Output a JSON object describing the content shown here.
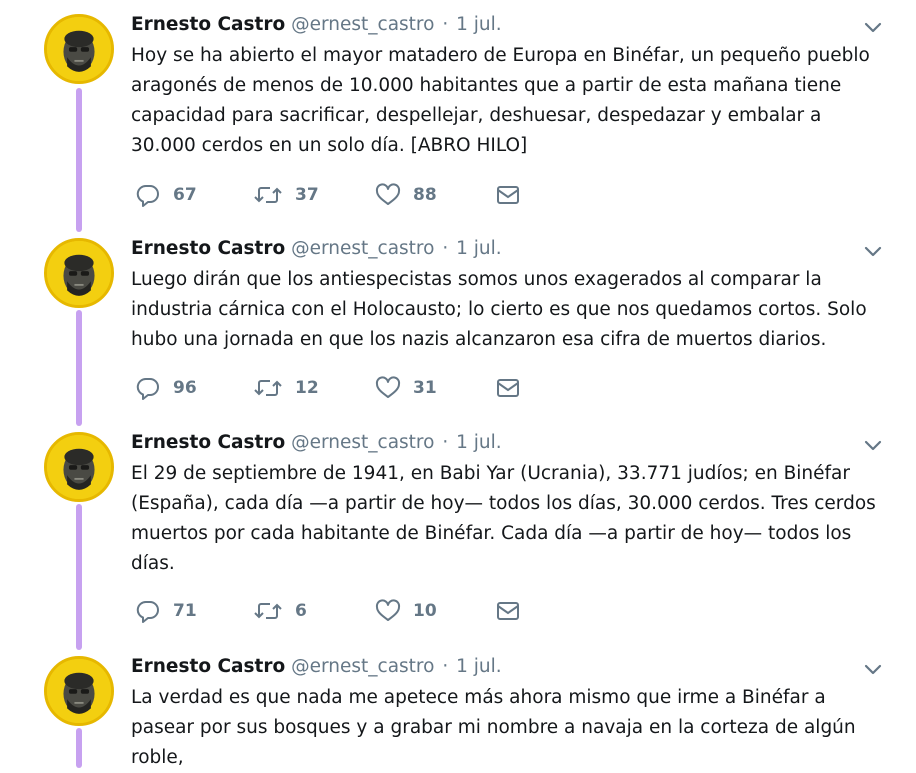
{
  "tweets": [
    {
      "name": "Ernesto Castro",
      "handle": "@ernest_castro",
      "date": "1 jul.",
      "text": "Hoy se ha abierto el mayor matadero de Europa en Binéfar, un pequeño pueblo aragonés de menos de 10.000 habitantes que a partir de esta mañana tiene capacidad para sacrificar, despellejar, deshuesar, despedazar y embalar a 30.000 cerdos en un solo día. [ABRO HILO]",
      "replies": "67",
      "retweets": "37",
      "likes": "88"
    },
    {
      "name": "Ernesto Castro",
      "handle": "@ernest_castro",
      "date": "1 jul.",
      "text": "Luego dirán que los antiespecistas somos unos exagerados al comparar la industria cárnica con el Holocausto; lo cierto es que nos quedamos cortos. Solo hubo una jornada en que los nazis alcanzaron esa cifra de muertos diarios.",
      "replies": "96",
      "retweets": "12",
      "likes": "31"
    },
    {
      "name": "Ernesto Castro",
      "handle": "@ernest_castro",
      "date": "1 jul.",
      "text": "El 29 de septiembre de 1941, en Babi Yar (Ucrania), 33.771 judíos; en Binéfar (España), cada día —a partir de hoy— todos los días, 30.000 cerdos. Tres cerdos muertos por cada habitante de Binéfar. Cada día —a partir de hoy— todos los días.",
      "replies": "71",
      "retweets": "6",
      "likes": "10"
    },
    {
      "name": "Ernesto Castro",
      "handle": "@ernest_castro",
      "date": "1 jul.",
      "text": "La verdad es que nada me apetece más ahora mismo que irme a Binéfar a pasear por sus bosques y a grabar mi nombre a navaja en la corteza de algún roble,"
    }
  ],
  "colors": {
    "thread_line": "#c7a1f0",
    "avatar_bg": "#f3cf10",
    "muted": "#657786",
    "text": "#14171a"
  },
  "icons": [
    "reply-icon",
    "retweet-icon",
    "like-icon",
    "dm-icon",
    "chevron-down-icon"
  ]
}
